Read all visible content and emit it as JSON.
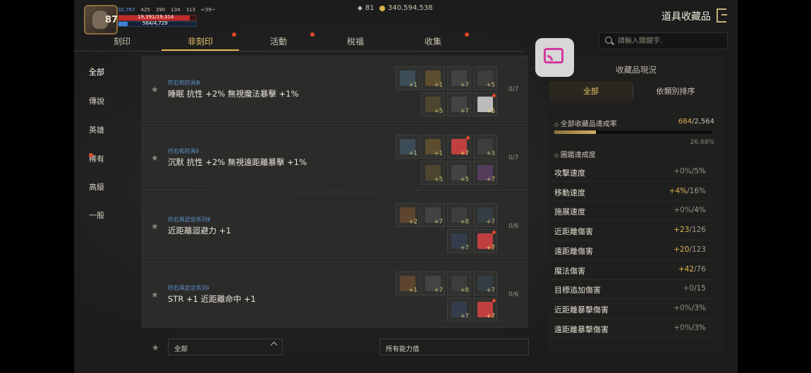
{
  "header": {
    "level": "87",
    "stats": [
      "32,767",
      "425",
      "390",
      "134",
      "313",
      "↩39~"
    ],
    "hp_text": "19,391/19,314",
    "mp_text": "564/4,729",
    "currency_a": "81",
    "currency_b": "340,594,538",
    "page_title": "道具收藏品"
  },
  "tabs": [
    {
      "label": "刻印",
      "dot": false
    },
    {
      "label": "非刻印",
      "dot": true,
      "active": true
    },
    {
      "label": "活動",
      "dot": true
    },
    {
      "label": "稅福",
      "dot": false
    },
    {
      "label": "收集",
      "dot": true
    }
  ],
  "search": {
    "placeholder": "請輸入關鍵字."
  },
  "categories": [
    {
      "label": "全部",
      "active": true
    },
    {
      "label": "傳說"
    },
    {
      "label": "英雄"
    },
    {
      "label": "稀有",
      "dot": true
    },
    {
      "label": "高級"
    },
    {
      "label": "一般"
    }
  ],
  "collections": [
    {
      "subtitle": "符石和防具Ⅲ",
      "title": "睡眠 抗性 +2% 無視魔法暴擊 +1%",
      "progress": "0/7",
      "slots": [
        {
          "plus": "+1",
          "color": "#4a6a80"
        },
        {
          "plus": "+1",
          "color": "#8a6a30"
        },
        {
          "plus": "+7",
          "color": "#555"
        },
        {
          "plus": "+5",
          "color": "#4a4a4a"
        },
        {
          "plus": "+5",
          "color": "#6a5a30"
        },
        {
          "plus": "+7",
          "color": "#555"
        },
        {
          "plus": "+5",
          "color": "#bbbbbb",
          "lit": true,
          "dot": true
        }
      ]
    },
    {
      "subtitle": "符石和防具Ⅱ",
      "title": "沉默 抗性 +2% 無視遠距離暴擊 +1%",
      "progress": "0/7",
      "slots": [
        {
          "plus": "+1",
          "color": "#4a6a80"
        },
        {
          "plus": "+1",
          "color": "#8a6a30"
        },
        {
          "plus": "+7",
          "color": "#c04040",
          "lit": true,
          "dot": true
        },
        {
          "plus": "+3",
          "color": "#4a4a4a"
        },
        {
          "plus": "+5",
          "color": "#6a5a30"
        },
        {
          "plus": "+5",
          "color": "#555"
        },
        {
          "plus": "+7",
          "color": "#7a4a8a"
        }
      ]
    },
    {
      "subtitle": "符石與武官系列Ⅱ",
      "title": "近距離迴避力 +1",
      "progress": "0/6",
      "slots": [
        {
          "plus": "+2",
          "color": "#8a5a30"
        },
        {
          "plus": "+7",
          "color": "#555"
        },
        {
          "plus": "+8",
          "color": "#4a4a4a"
        },
        {
          "plus": "+7",
          "color": "#3a4a5a"
        },
        {
          "plus": "+7",
          "color": "#3a4a6a"
        },
        {
          "plus": "+7",
          "color": "#c04040",
          "lit": true,
          "dot": true
        }
      ]
    },
    {
      "subtitle": "符石與武官系列Ⅰ",
      "title": "STR +1 近距離命中 +1",
      "progress": "0/6",
      "slots": [
        {
          "plus": "+1",
          "color": "#8a5a30"
        },
        {
          "plus": "+7",
          "color": "#555"
        },
        {
          "plus": "+8",
          "color": "#4a4a4a"
        },
        {
          "plus": "+7",
          "color": "#3a4a5a"
        },
        {
          "plus": "+7",
          "color": "#3a4a6a"
        },
        {
          "plus": "+7",
          "color": "#c04040",
          "lit": true,
          "dot": true
        }
      ]
    }
  ],
  "filters": {
    "grade": "全部",
    "ability": "所有能力值"
  },
  "panel": {
    "title": "收藏品現況",
    "seg_all": "全部",
    "seg_sort": "依類別排序",
    "achievement_label": "全部收藏品達成率",
    "achievement_current": "684",
    "achievement_total": "/2,564",
    "achievement_pct": "26.68%",
    "book_label": "圖鑑達成度",
    "stats": [
      {
        "name": "攻擊速度",
        "cur": "+0%",
        "max": "/5%",
        "hi": false
      },
      {
        "name": "移動速度",
        "cur": "+4%",
        "max": "/16%",
        "hi": true
      },
      {
        "name": "施展速度",
        "cur": "+0%",
        "max": "/4%",
        "hi": false
      },
      {
        "name": "近距離傷害",
        "cur": "+23",
        "max": "/126",
        "hi": true
      },
      {
        "name": "遠距離傷害",
        "cur": "+20",
        "max": "/123",
        "hi": true
      },
      {
        "name": "魔法傷害",
        "cur": "+42",
        "max": "/76",
        "hi": true
      },
      {
        "name": "目標追加傷害",
        "cur": "+0",
        "max": "/15",
        "hi": false
      },
      {
        "name": "近距離暴擊傷害",
        "cur": "+0%",
        "max": "/3%",
        "hi": false
      },
      {
        "name": "遠距離暴擊傷害",
        "cur": "+0%",
        "max": "/3%",
        "hi": false
      }
    ]
  },
  "colors": {
    "accent": "#e0b550",
    "notify": "#e04a2a",
    "subtitle_blue": "#5c8fc9"
  }
}
